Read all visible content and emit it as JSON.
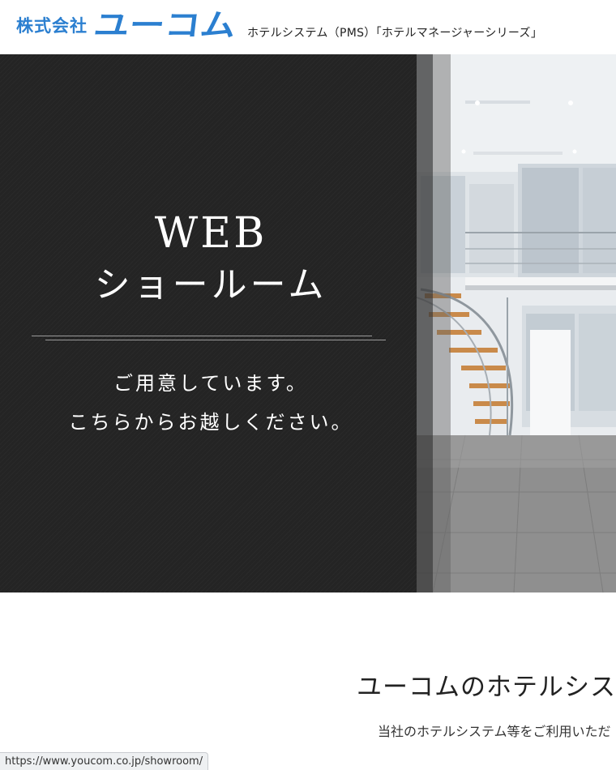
{
  "header": {
    "logo_kaisha": "株式会社",
    "logo_name": "ユーコム",
    "tagline": "ホテルシステム（PMS）「ホテルマネージャーシリーズ」"
  },
  "hero": {
    "title_line1": "WEB",
    "title_line2": "ショールーム",
    "sub_line1": "ご用意しています。",
    "sub_line2": "こちらからお越しください。"
  },
  "content": {
    "heading": "ユーコムのホテルシステ",
    "text": "当社のホテルシステム等をご利用いただ"
  },
  "status_bar": {
    "url": "https://www.youcom.co.jp/showroom/"
  },
  "colors": {
    "brand": "#2b7fd0",
    "hero_dark": "#242424"
  }
}
